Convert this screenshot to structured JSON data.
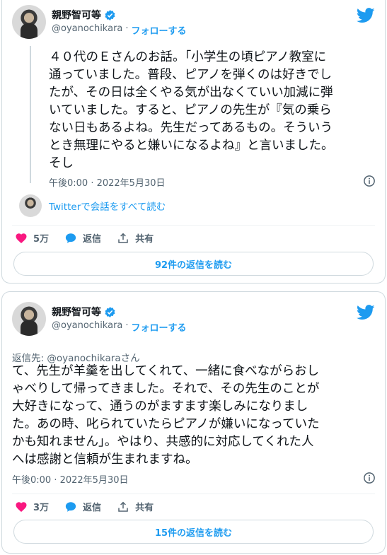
{
  "colors": {
    "accent": "#1d9bf0",
    "like": "#f91880",
    "muted": "#536471",
    "text": "#0f1419",
    "border": "#cfd9de"
  },
  "tweets": [
    {
      "author_name": "親野智可等",
      "handle": "@oyanochikara",
      "separator": "·",
      "follow_label": "フォローする",
      "text": "４０代のＥさんのお話。「小学生の頃ピアノ教室に\n通っていました。普段、ピアノを弾くのは好きでし\nたが、その日は全くやる気が出なくていい加減に弾\nいていました。すると、ピアノの先生が『気の乗ら\nない日もあるよね。先生だってあるもの。そういう\nとき無理にやると嫌いになるよね』と言いました。\nそし",
      "timestamp": "午後0:00 · 2022年5月30日",
      "conversation_link": "Twitterで会話をすべて読む",
      "likes": "5万",
      "reply_label": "返信",
      "share_label": "共有",
      "read_replies": "92件の返信を読む"
    },
    {
      "author_name": "親野智可等",
      "handle": "@oyanochikara",
      "separator": "·",
      "follow_label": "フォローする",
      "reply_to_prefix": "返信先: ",
      "reply_to_handle": "@oyanochikara",
      "reply_to_suffix": "さん",
      "text": "て、先生が羊羹を出してくれて、一緒に食べながらおし\nゃべりして帰ってきました。それで、その先生のことが\n大好きになって、通うのがますます楽しみになりまし\nた。あの時、叱られていたらピアノが嫌いになっていた\nかも知れません」。やはり、共感的に対応してくれた人\nへは感謝と信頼が生まれますね。",
      "timestamp": "午後0:00 · 2022年5月30日",
      "likes": "3万",
      "reply_label": "返信",
      "share_label": "共有",
      "read_replies": "15件の返信を読む"
    }
  ]
}
